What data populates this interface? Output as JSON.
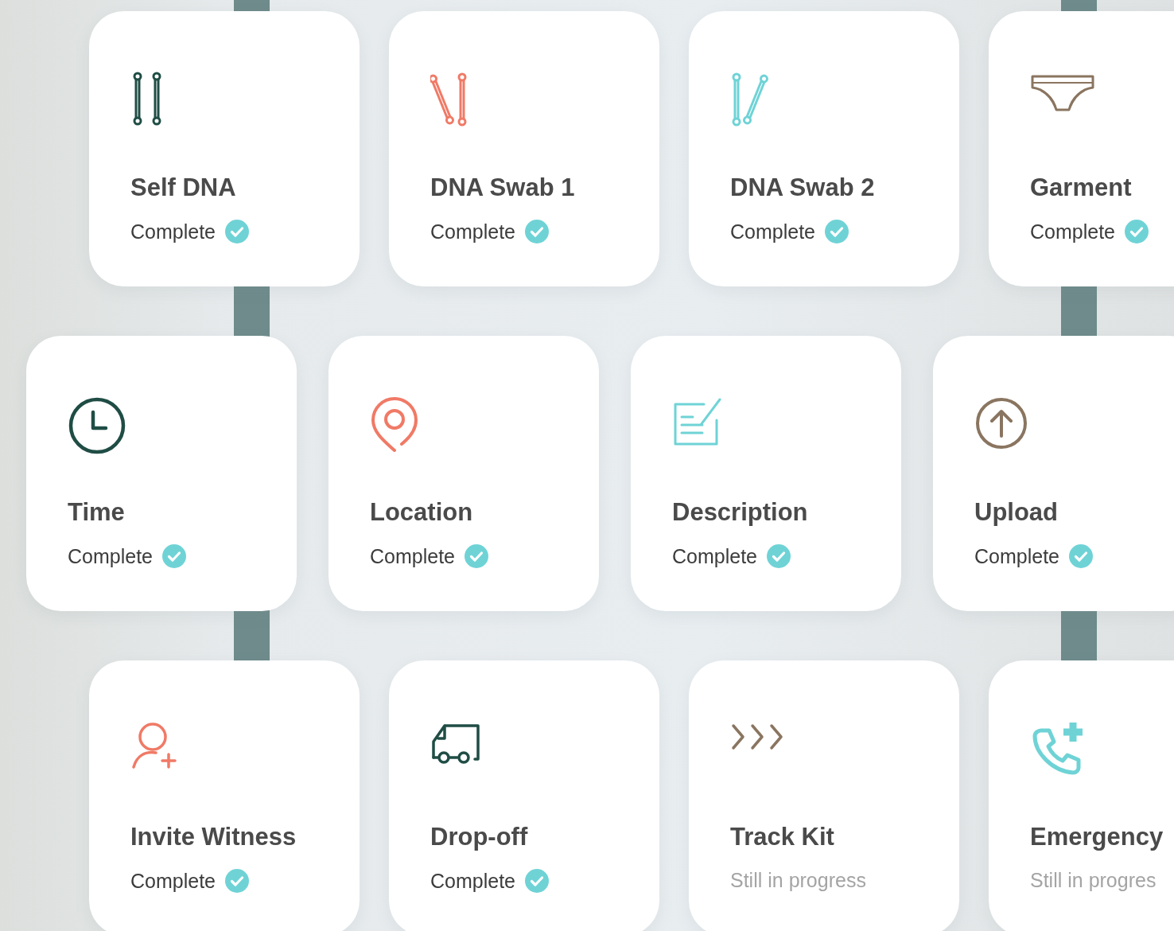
{
  "rows": [
    {
      "cards": [
        {
          "kind": "swab-pair",
          "color": "#1f4d45",
          "title": "Self DNA",
          "status": "Complete",
          "complete": true
        },
        {
          "kind": "swab-tilted",
          "color": "#f07a66",
          "title": "DNA Swab 1",
          "status": "Complete",
          "complete": true
        },
        {
          "kind": "swab-slanted",
          "color": "#6fd3d6",
          "title": "DNA Swab 2",
          "status": "Complete",
          "complete": true
        },
        {
          "kind": "garment",
          "color": "#8a7560",
          "title": "Garment",
          "status": "Complete",
          "complete": true
        }
      ]
    },
    {
      "cards": [
        {
          "kind": "clock",
          "color": "#1f4d45",
          "title": "Time",
          "status": "Complete",
          "complete": true
        },
        {
          "kind": "pin",
          "color": "#f07a66",
          "title": "Location",
          "status": "Complete",
          "complete": true
        },
        {
          "kind": "note",
          "color": "#6fd3d6",
          "title": "Description",
          "status": "Complete",
          "complete": true
        },
        {
          "kind": "upload",
          "color": "#8a7560",
          "title": "Upload",
          "status": "Complete",
          "complete": true
        }
      ]
    },
    {
      "cards": [
        {
          "kind": "person-add",
          "color": "#f07a66",
          "title": "Invite Witness",
          "status": "Complete",
          "complete": true
        },
        {
          "kind": "van",
          "color": "#1f4d45",
          "title": "Drop-off",
          "status": "Complete",
          "complete": true
        },
        {
          "kind": "chevrons",
          "color": "#8a7560",
          "title": "Track Kit",
          "status": "Still in progress",
          "complete": false
        },
        {
          "kind": "phone-plus",
          "color": "#6fd3d6",
          "title": "Emergency",
          "status": "Still in progres",
          "complete": false
        }
      ]
    }
  ]
}
